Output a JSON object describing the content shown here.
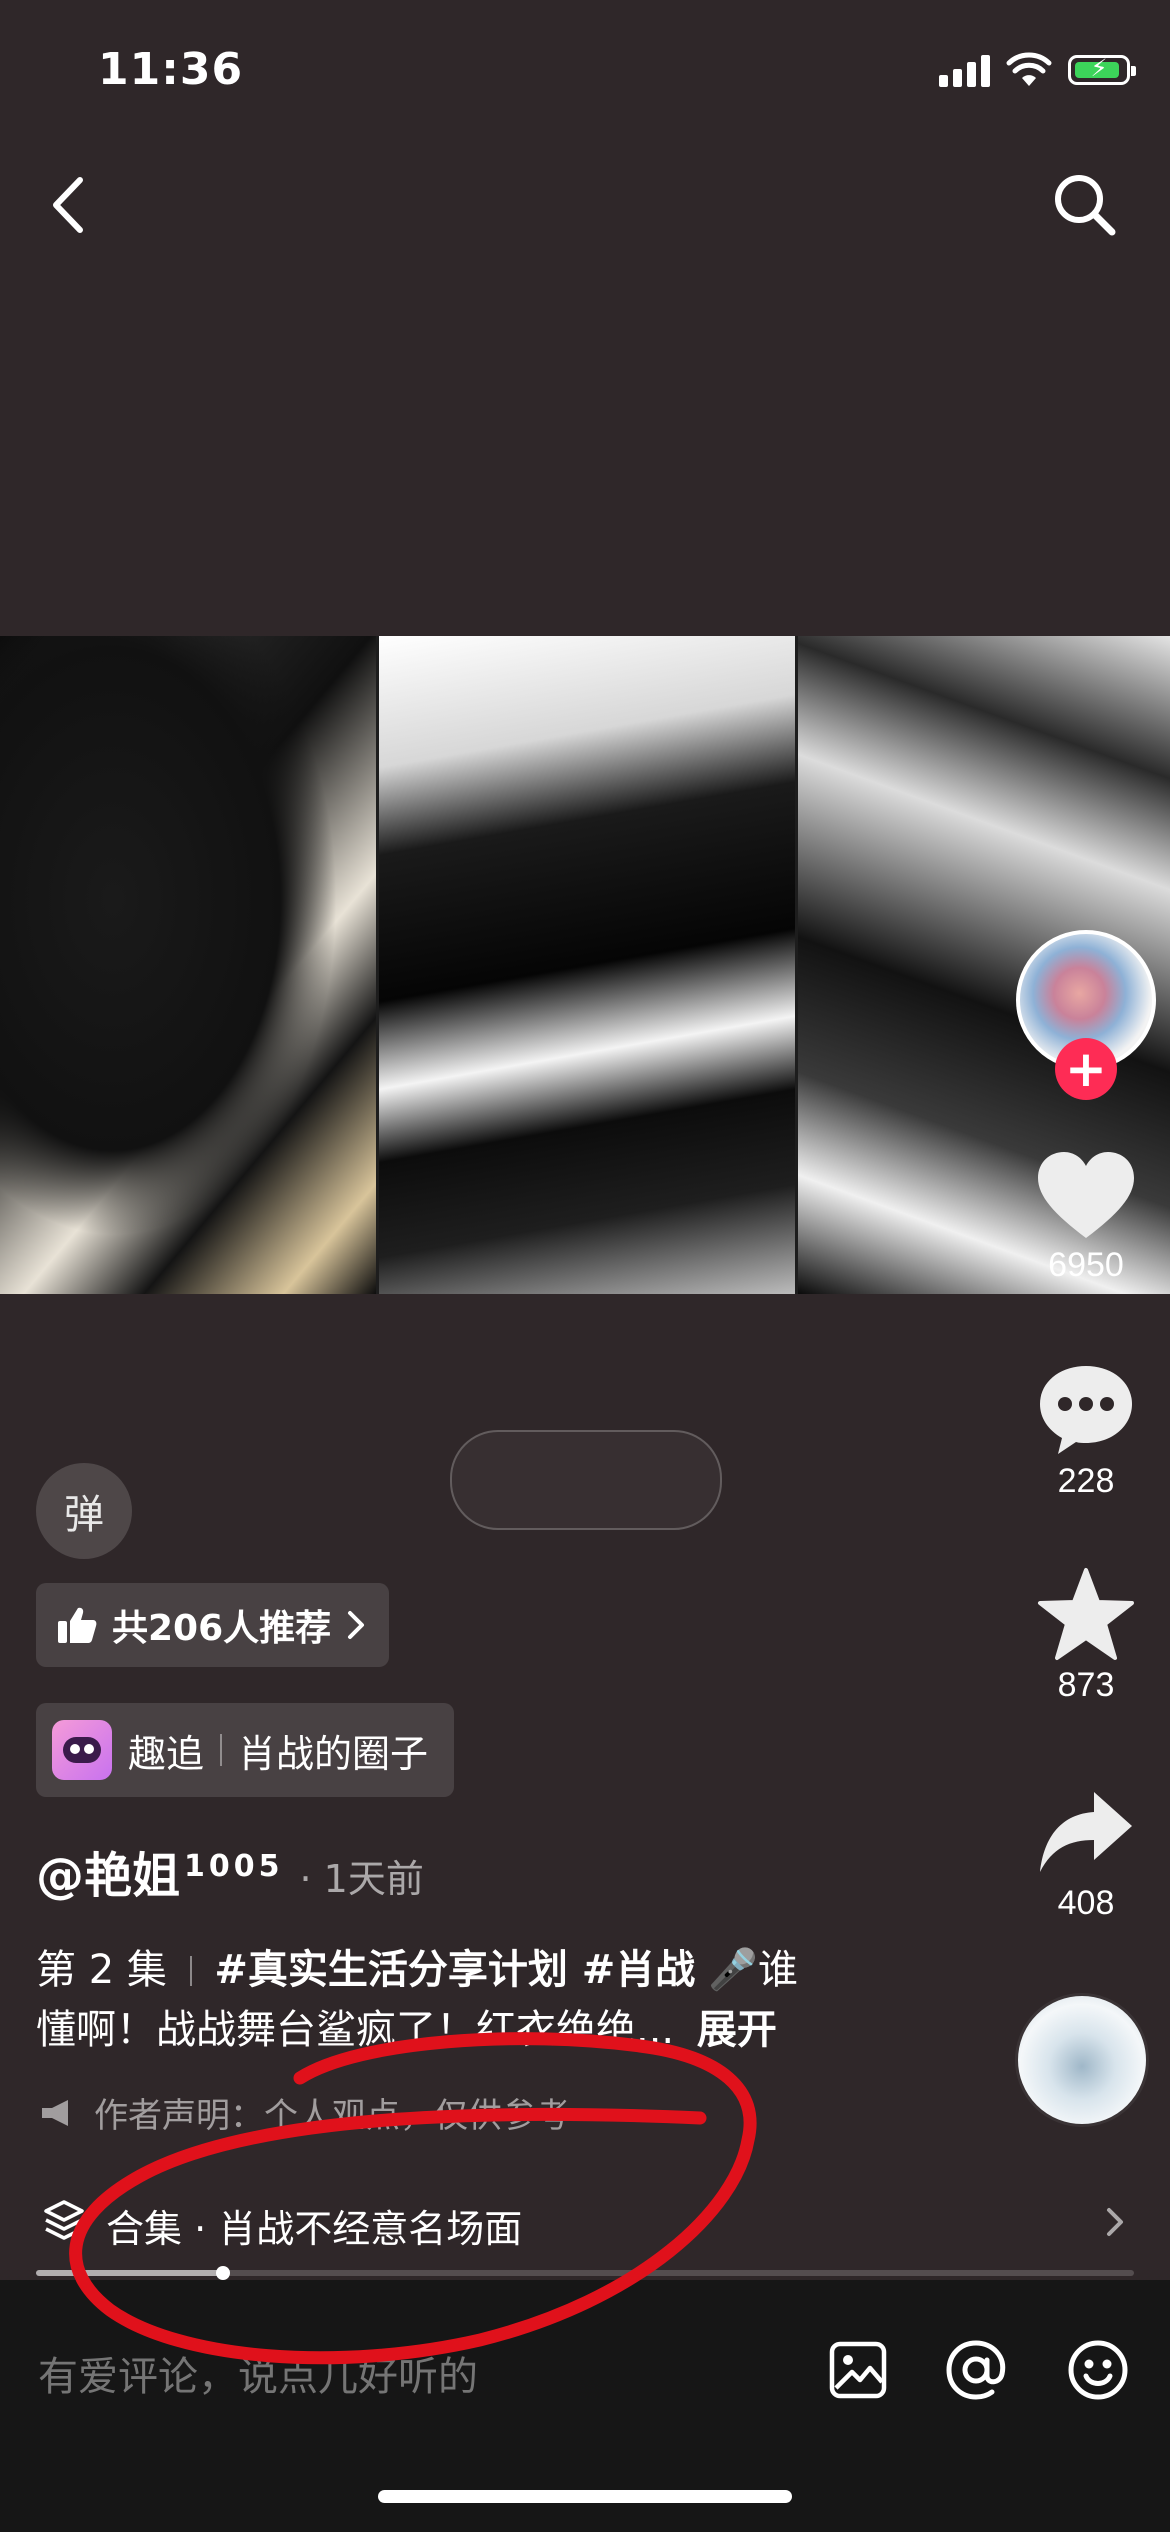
{
  "status_bar": {
    "time": "11:36"
  },
  "colors": {
    "background": "#2f2729",
    "follow_button": "#fe2c55",
    "highlight_annotation": "#e0111b",
    "battery_fill": "#3cd45a"
  },
  "icons": {
    "back": "chevron-left",
    "search": "magnifier",
    "like": "heart",
    "comment": "speech-bubble",
    "favorite": "star",
    "share": "share-arrow"
  },
  "actions": {
    "likes": "6950",
    "comments": "228",
    "favorites": "873",
    "shares": "408"
  },
  "danmaku": {
    "label": "弹"
  },
  "recommend": {
    "label": "共206人推荐"
  },
  "quzhui": {
    "label": "趣追",
    "circle": "肖战的圈子"
  },
  "post": {
    "author": "@艳姐",
    "author_suffix": "1005",
    "time": "· 1天前",
    "episode": "第 2 集",
    "tags": "#真实生活分享计划 #肖战",
    "text_line1_tail": "谁",
    "text_line2": "懂啊！战战舞台鲨疯了！红衣绝绝...",
    "expand": "展开",
    "disclaimer": "作者声明：个人观点，仅供参考"
  },
  "collection": {
    "label": "合集 · 肖战不经意名场面",
    "progress": 0.17
  },
  "comment_bar": {
    "placeholder": "有爱评论，说点儿好听的"
  }
}
